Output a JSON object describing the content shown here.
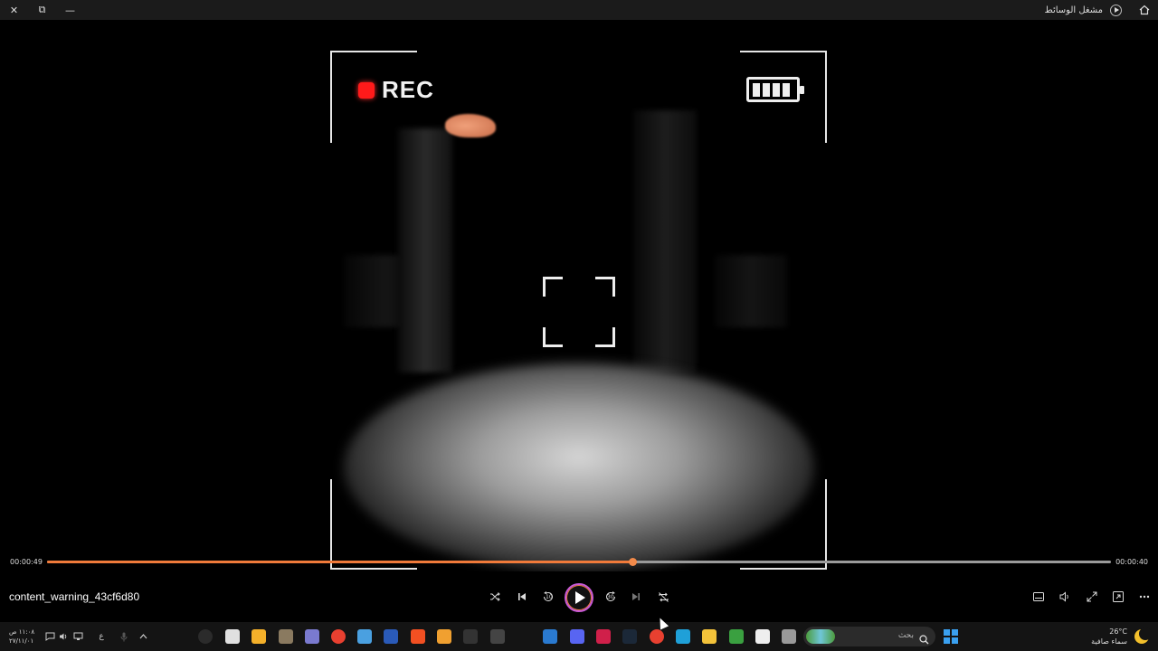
{
  "window": {
    "title": "مشغل الوسائط",
    "close_glyph": "✕",
    "restore_glyph": "⧉",
    "minimize_glyph": "—"
  },
  "video": {
    "rec_label": "REC",
    "battery_bars": 4
  },
  "playback": {
    "current_time": "00:00:49",
    "duration": "00:00:40",
    "progress_fraction": 0.55,
    "file_name": "content_warning_43cf6d80",
    "skip_back_label": "10",
    "skip_forward_label": "30"
  },
  "taskbar": {
    "clock_time": "١١:٠٨ ص",
    "clock_date": "٢٧/١١/٠١",
    "language": "ع",
    "search_placeholder": "بحث",
    "weather_temp": "26°C",
    "weather_desc": "سماء صافية",
    "app_icons": [
      {
        "name": "media-player-icon",
        "color": "#2b2b2b"
      },
      {
        "name": "settings-icon",
        "color": "#e0e0e0"
      },
      {
        "name": "chat-app-icon",
        "color": "#f4b02a"
      },
      {
        "name": "gimp-icon",
        "color": "#8a7a60"
      },
      {
        "name": "python-icon",
        "color": "#7a7acf"
      },
      {
        "name": "chrome-beta-icon",
        "color": "#e84030"
      },
      {
        "name": "w-app-icon",
        "color": "#4aa0e0"
      },
      {
        "name": "word-icon",
        "color": "#2a5ab8"
      },
      {
        "name": "microsoft-store-icon",
        "color": "#f25022"
      },
      {
        "name": "blender-icon",
        "color": "#f0a030"
      },
      {
        "name": "epic-games-icon",
        "color": "#333333"
      },
      {
        "name": "obs-icon",
        "color": "#444444"
      },
      {
        "name": "outlook-icon",
        "color": "#2a7ad0"
      },
      {
        "name": "discord-icon",
        "color": "#5865f2"
      },
      {
        "name": "adobe-icon",
        "color": "#d0204a"
      },
      {
        "name": "steam-icon",
        "color": "#1b2838"
      },
      {
        "name": "chrome-icon",
        "color": "#e84030"
      },
      {
        "name": "edge-icon",
        "color": "#1fa0d8"
      },
      {
        "name": "file-explorer-icon",
        "color": "#f2c23a"
      },
      {
        "name": "chrome-dev-icon",
        "color": "#3aa040"
      },
      {
        "name": "store-bag-icon",
        "color": "#eeeeee"
      },
      {
        "name": "task-view-icon",
        "color": "#9a9a9a"
      }
    ]
  }
}
